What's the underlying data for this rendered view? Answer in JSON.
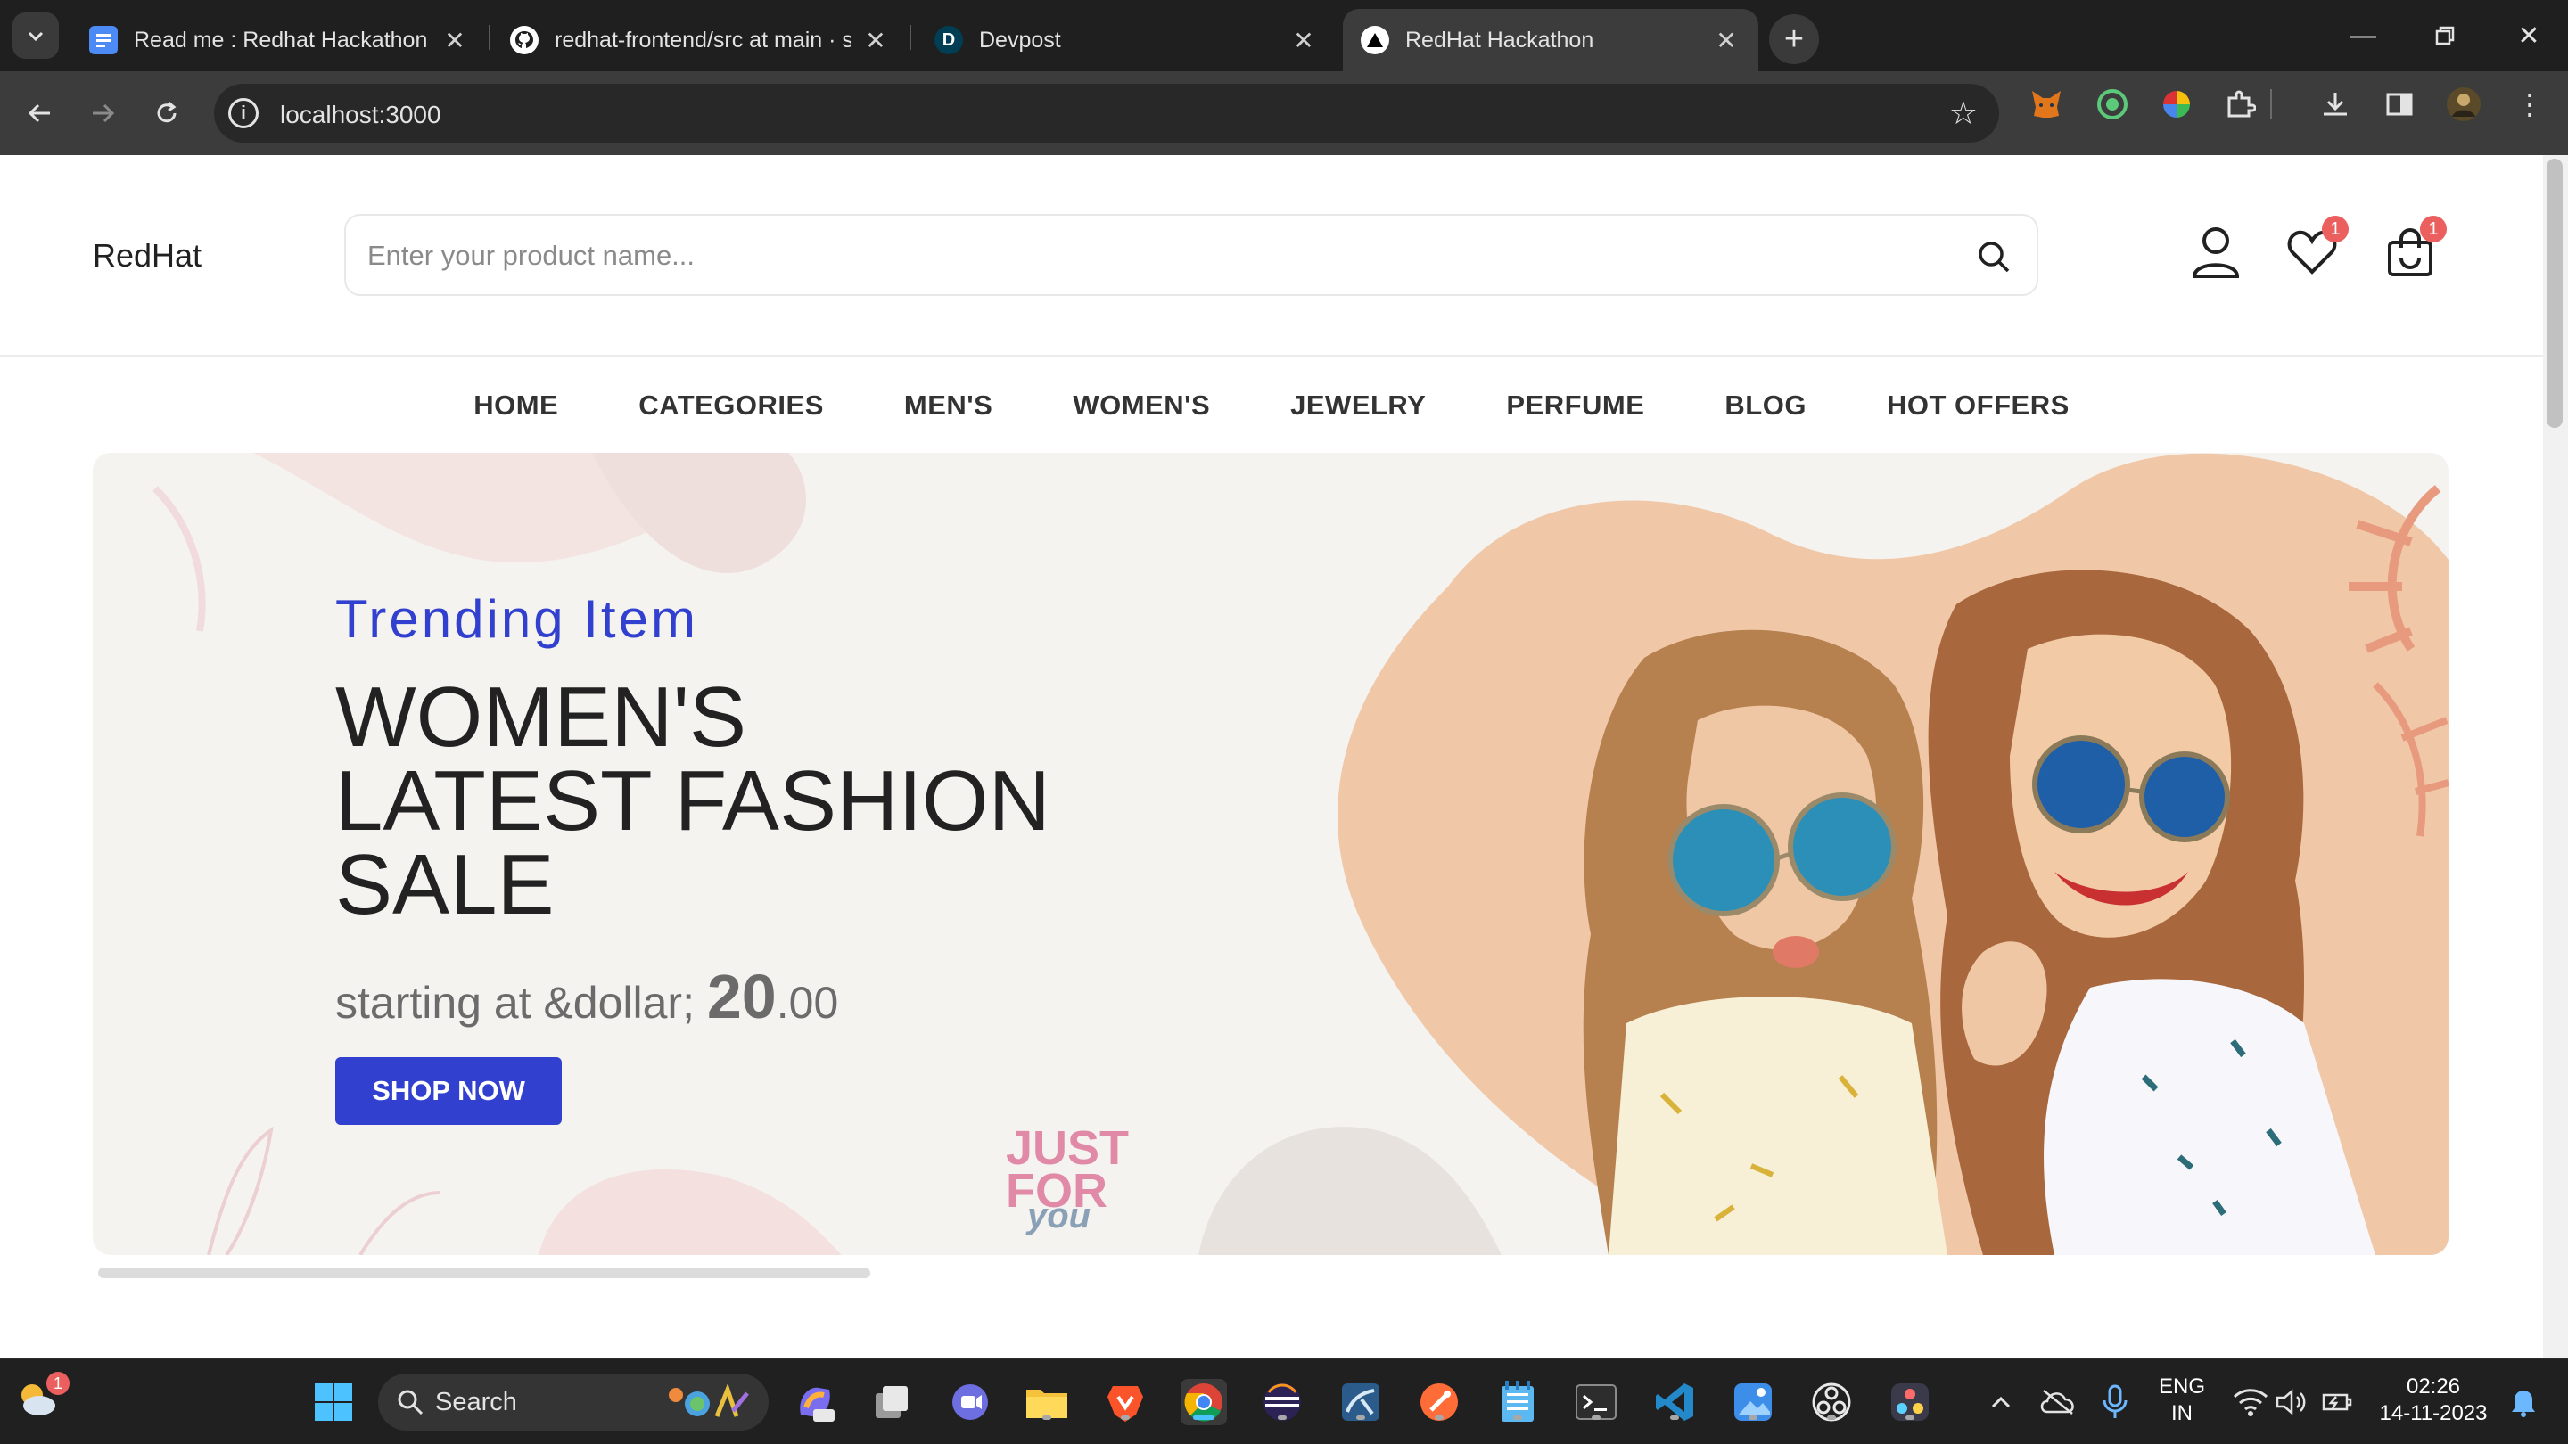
{
  "browser": {
    "tabs": [
      {
        "title": "Read me : Redhat Hackathon - (",
        "favicon": "docs-icon",
        "color": "#4c8bf5"
      },
      {
        "title": "redhat-frontend/src at main · su",
        "favicon": "github-icon",
        "color": "#ffffff"
      },
      {
        "title": "Devpost",
        "favicon": "devpost-icon",
        "color": "#003e54"
      },
      {
        "title": "RedHat Hackathon",
        "favicon": "nextjs-icon",
        "color": "#000000"
      }
    ],
    "url": "localhost:3000"
  },
  "site": {
    "brand": "RedHat",
    "search_placeholder": "Enter your product name...",
    "wishlist_count": "1",
    "cart_count": "1",
    "nav": [
      "HOME",
      "CATEGORIES",
      "MEN'S",
      "WOMEN'S",
      "JEWELRY",
      "PERFUME",
      "BLOG",
      "HOT OFFERS"
    ]
  },
  "hero": {
    "subtitle": "Trending Item",
    "title_lines": [
      "WOMEN'S",
      "LATEST FASHION",
      "SALE"
    ],
    "price_prefix": "starting at &dollar; ",
    "price_main": "20",
    "price_decimal": ".00",
    "button": "SHOP NOW",
    "stamp_line1": "JUST",
    "stamp_line2": "FOR",
    "stamp_line3": "you"
  },
  "taskbar": {
    "search": "Search",
    "lang1": "ENG",
    "lang2": "IN",
    "time": "02:26",
    "date": "14-11-2023",
    "weather_badge": "1"
  },
  "colors": {
    "accent": "#3240cf",
    "badge": "#ec5f5f",
    "chrome_dark": "#1f1f1f"
  }
}
